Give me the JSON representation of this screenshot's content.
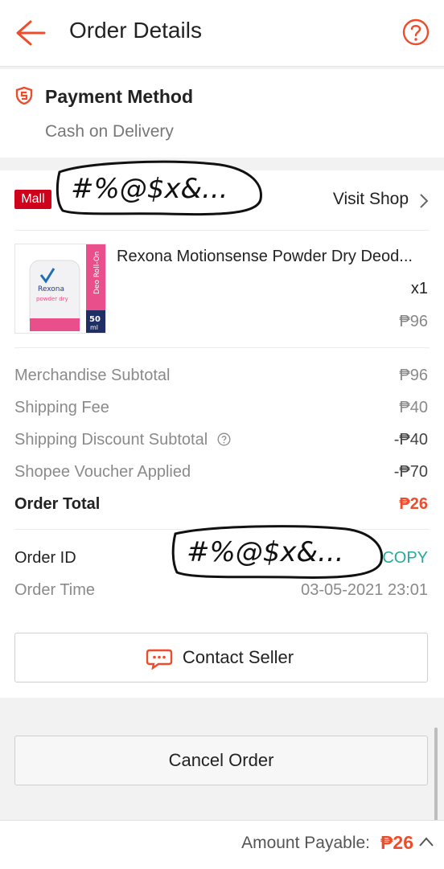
{
  "header": {
    "title": "Order Details"
  },
  "payment": {
    "title": "Payment Method",
    "value": "Cash on Delivery"
  },
  "shop": {
    "badge": "Mall",
    "redacted_name": "#%@$x&...",
    "visit_label": "Visit Shop"
  },
  "product": {
    "name": "Rexona Motionsense Powder Dry Deod...",
    "qty": "x1",
    "price": "₱96",
    "thumb_brand": "Rexona",
    "thumb_variant": "powder dry",
    "thumb_tag": "Deo Roll-On",
    "thumb_size": "50",
    "thumb_unit": "ml"
  },
  "summary": [
    {
      "label": "Merchandise Subtotal",
      "value": "₱96"
    },
    {
      "label": "Shipping Fee",
      "value": "₱40"
    },
    {
      "label": "Shipping Discount Subtotal",
      "value": "-₱40"
    },
    {
      "label": "Shopee Voucher Applied",
      "value": "-₱70"
    },
    {
      "label": "Order Total",
      "value": "₱26"
    }
  ],
  "order": {
    "id_label": "Order ID",
    "id_redacted": "#%@$x&...",
    "copy_label": "COPY",
    "time_label": "Order Time",
    "time_value": "03-05-2021 23:01"
  },
  "buttons": {
    "contact": "Contact Seller",
    "cancel": "Cancel Order"
  },
  "footer": {
    "payable_label": "Amount Payable:",
    "payable_value": "₱26"
  },
  "colors": {
    "accent": "#ee4d2d",
    "mall": "#d0011b",
    "copy": "#26aa99"
  }
}
